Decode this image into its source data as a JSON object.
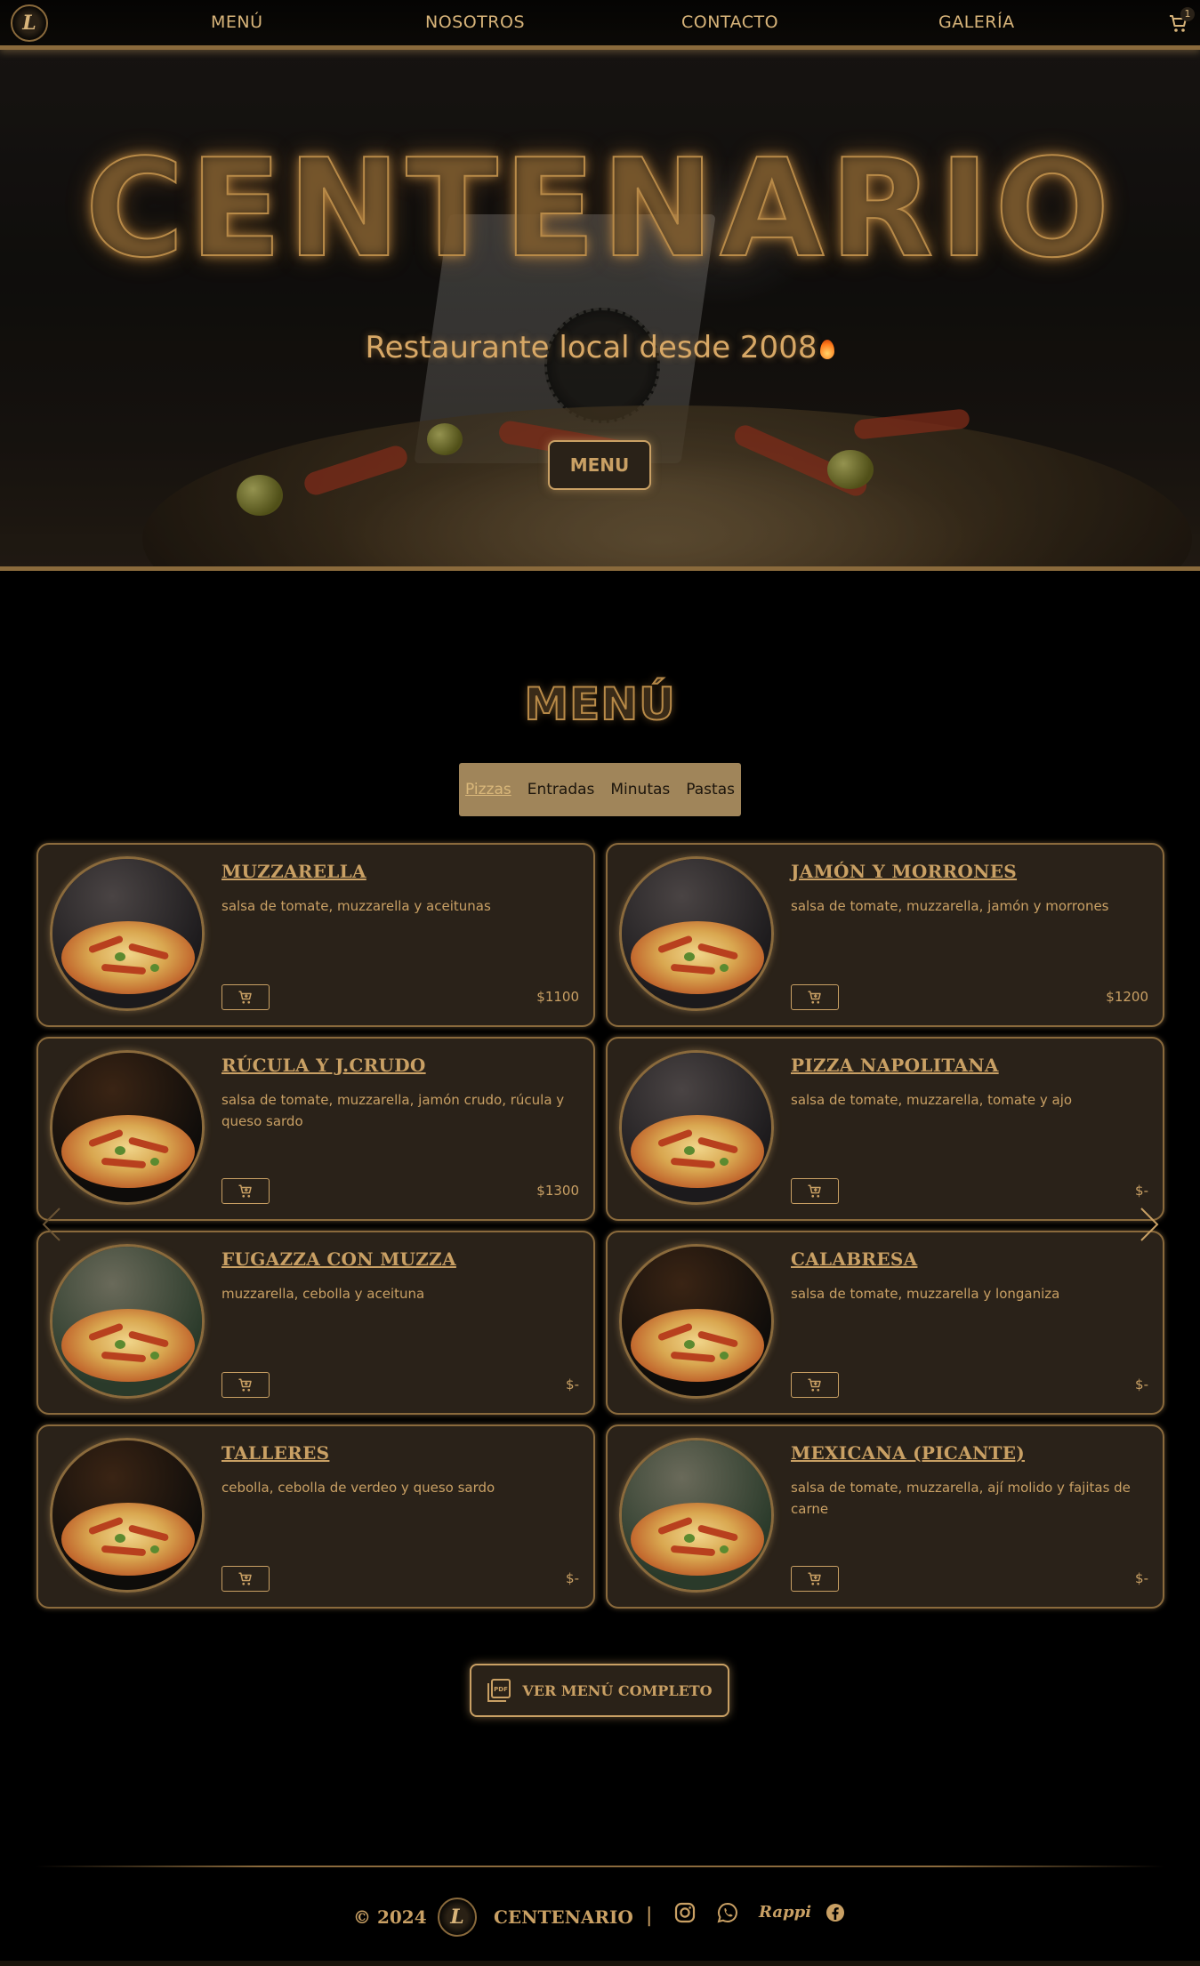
{
  "nav": {
    "logo_text": "L",
    "links": [
      "MENÚ",
      "NOSOTROS",
      "CONTACTO",
      "GALERÍA"
    ],
    "cart_count": "1"
  },
  "hero": {
    "title": "CENTENARIO",
    "subtitle": "Restaurante local desde 2008",
    "button": "MENU"
  },
  "menu": {
    "heading": "MENÚ",
    "tabs": [
      "Pizzas",
      "Entradas",
      "Minutas",
      "Pastas"
    ],
    "active_tab": "Pizzas",
    "items": [
      {
        "name": "MUZZARELLA",
        "desc": "salsa de tomate, muzzarella y aceitunas",
        "price": "$1100"
      },
      {
        "name": "JAMÓN Y MORRONES",
        "desc": "salsa de tomate, muzzarella, jamón y morrones",
        "price": "$1200"
      },
      {
        "name": "RÚCULA Y J.CRUDO",
        "desc": "salsa de tomate, muzzarella, jamón crudo, rúcula y queso sardo",
        "price": "$1300"
      },
      {
        "name": "PIZZA NAPOLITANA",
        "desc": "salsa de tomate, muzzarella, tomate y ajo",
        "price": "$-"
      },
      {
        "name": "FUGAZZA CON MUZZA",
        "desc": "muzzarella, cebolla y aceituna",
        "price": "$-"
      },
      {
        "name": "CALABRESA",
        "desc": "salsa de tomate, muzzarella y longaniza",
        "price": "$-"
      },
      {
        "name": "TALLERES",
        "desc": "cebolla, cebolla de verdeo y queso sardo",
        "price": "$-"
      },
      {
        "name": "MEXICANA (PICANTE)",
        "desc": "salsa de tomate, muzzarella, ají molido y fajitas de carne",
        "price": "$-"
      }
    ],
    "full_menu_button": "VER MENÚ COMPLETO",
    "pdf_label": "PDF"
  },
  "footer": {
    "copyright": "© 2024",
    "name": "CENTENARIO",
    "separator": "|",
    "rappi": "Rappi",
    "logo_text": "L"
  },
  "colors": {
    "accent": "#c9a064",
    "card_bg": "#2a2219",
    "border": "#8a6a3c",
    "background": "#000000"
  }
}
